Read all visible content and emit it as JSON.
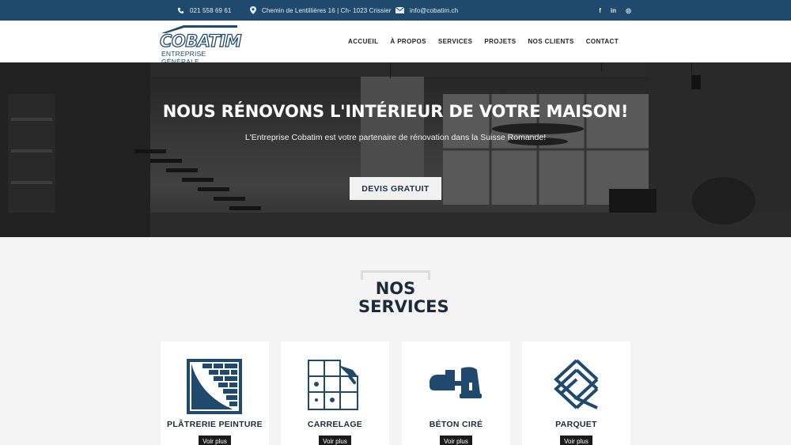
{
  "topbar": {
    "phone": "021 558 69 61",
    "address": "Chemin de Lentillières 16 | Ch- 1023 Crissier",
    "email": "info@cobatim.ch",
    "social": [
      "f",
      "in",
      "◎"
    ],
    "icons": [
      "phone-icon",
      "location-pin-icon",
      "envelope-icon",
      "facebook-icon",
      "linkedin-icon",
      "instagram-icon"
    ]
  },
  "header": {
    "logo_name": "COBATIM",
    "logo_tagline": "ENTREPRISE GÉNÉRALE",
    "nav": [
      "ACCUEIL",
      "À PROPOS",
      "SERVICES",
      "PROJETS",
      "NOS CLIENTS",
      "CONTACT"
    ]
  },
  "hero": {
    "title": "NOUS RÉNOVONS L'INTÉRIEUR DE VOTRE MAISON!",
    "subtitle": "L'Entreprise Cobatim est votre partenaire de rénovation dans la Suisse Romande!",
    "cta": "DEVIS GRATUIT"
  },
  "services": {
    "title_line1": "NOS",
    "title_line2": "SERVICES",
    "cards": [
      {
        "name": "PLÂTRERIE PEINTURE",
        "button": "Voir plus",
        "icon": "plaster-wall-icon"
      },
      {
        "name": "CARRELAGE",
        "button": "Voir plus",
        "icon": "tiles-trowel-icon"
      },
      {
        "name": "BÉTON CIRÉ",
        "button": "Voir plus",
        "icon": "concrete-sander-icon"
      },
      {
        "name": "PARQUET",
        "button": "Voir plus",
        "icon": "parquet-planks-icon"
      }
    ]
  },
  "colors": {
    "brand_blue": "#1f4a6e",
    "dark_text": "#1e2a38",
    "icon_blue": "#1f4a6e"
  }
}
